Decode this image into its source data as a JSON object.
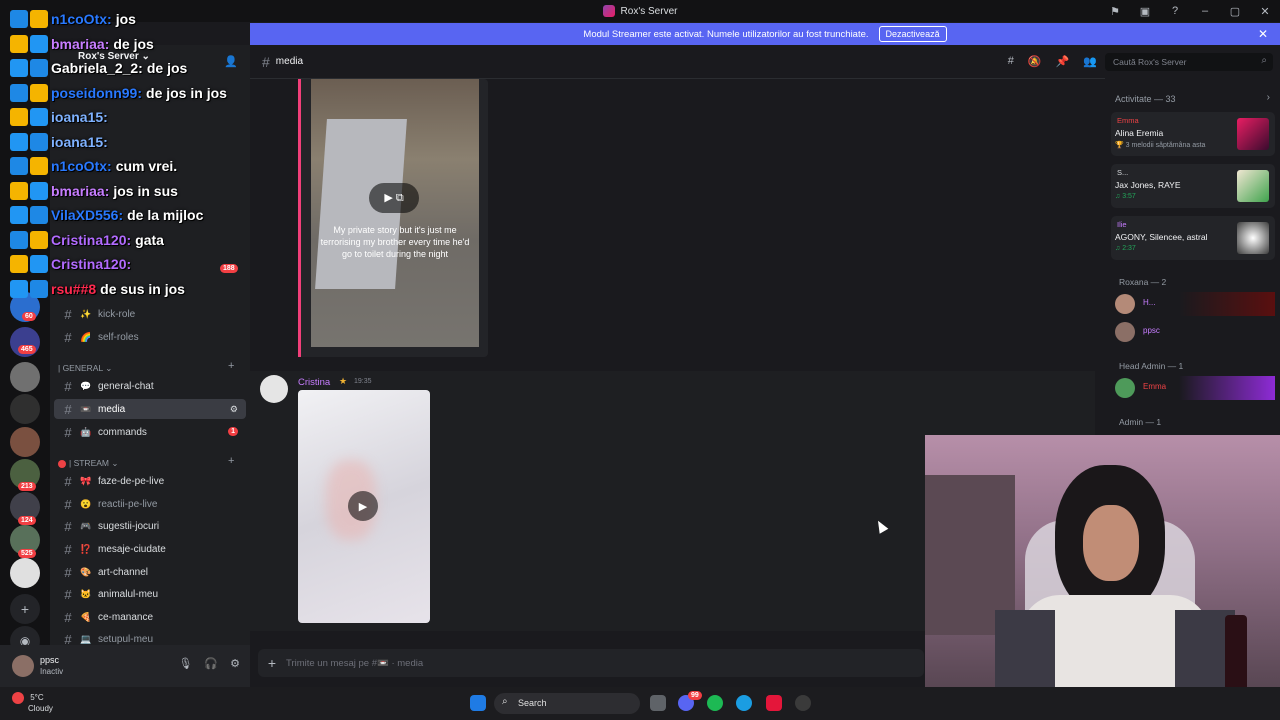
{
  "window": {
    "title": "Rox's Server",
    "controls": [
      "–",
      "▢",
      "✕"
    ]
  },
  "banner": {
    "text": "Modul Streamer este activat. Numele utilizatorilor au fost trunchiate.",
    "button": "Dezactivează",
    "close": "✕"
  },
  "server_list": {
    "badges": [
      "465",
      "213",
      "124",
      "525",
      "60"
    ]
  },
  "sidebar": {
    "server_name": "Rox's Server ⌄",
    "channels_top": [
      {
        "emoji": "✨",
        "label": "kick-role"
      },
      {
        "emoji": "🌈",
        "label": "self-roles"
      }
    ],
    "category_general": "| GENERAL ⌄",
    "channels_general": [
      {
        "emoji": "💬",
        "label": "general-chat"
      },
      {
        "emoji": "📼",
        "label": "media"
      },
      {
        "emoji": "🤖",
        "label": "commands",
        "badge": "1"
      }
    ],
    "category_stream": "| STREAM ⌄",
    "channels_stream": [
      {
        "emoji": "🎀",
        "label": "faze-de-pe-live"
      },
      {
        "emoji": "😮",
        "label": "reactii-pe-live"
      },
      {
        "emoji": "🎮",
        "label": "sugestii-jocuri"
      },
      {
        "emoji": "⁉️",
        "label": "mesaje-ciudate"
      },
      {
        "emoji": "🎨",
        "label": "art-channel"
      },
      {
        "emoji": "🐱",
        "label": "animalul-meu"
      },
      {
        "emoji": "🍕",
        "label": "ce-manance"
      },
      {
        "emoji": "💻",
        "label": "setupul-meu"
      }
    ],
    "mentions_badge": "188"
  },
  "user_panel": {
    "name": "ppsc",
    "status": "Inactiv"
  },
  "channel_header": {
    "name": "media",
    "prefix": "#"
  },
  "search": {
    "placeholder": "Caută Rox's Server"
  },
  "messages": {
    "embed_caption": "My private story but it's just me terrorising my brother every time he'd go to toilet during the night",
    "author": "Cristina",
    "time": "19:35"
  },
  "composer": {
    "placeholder": "Trimite un mesaj pe #📼 · media"
  },
  "activity": {
    "header": "Activitate — 33",
    "cards": [
      {
        "top": "Emma",
        "title": "Alina Eremia",
        "sub": "🏆 3 melodii săptămâna asta"
      },
      {
        "top": "S...",
        "title": "Jax Jones, RAYE",
        "sub": "♫ 3:57"
      },
      {
        "top": "Ilie",
        "title": "AGONY, Silencee, astral",
        "sub": "♫ 2:37"
      }
    ],
    "roles": [
      {
        "label": "Roxana — 2"
      },
      {
        "label": "Head Admin — 1"
      },
      {
        "label": "Admin — 1"
      }
    ],
    "members": [
      "H...",
      "ppsc",
      "Emma"
    ]
  },
  "taskbar": {
    "temp": "5°C",
    "weather": "Cloudy",
    "search": "Search",
    "discord_badge": "99"
  },
  "stream_chat": [
    {
      "user": "n1coOtx:",
      "text": "jos",
      "color": "#2979ff"
    },
    {
      "user": "bmariaa:",
      "text": "de jos",
      "color": "#c77dff"
    },
    {
      "user": "Gabriela_2_2:",
      "text": "de jos",
      "color": "#ffffff"
    },
    {
      "user": "poseidonn99:",
      "text": "de jos in jos",
      "color": "#2979ff"
    },
    {
      "user": "ioana15:",
      "text": "",
      "color": "#7fb2ff"
    },
    {
      "user": "ioana15:",
      "text": "",
      "color": "#7fb2ff"
    },
    {
      "user": "n1coOtx:",
      "text": "cum vrei.",
      "color": "#2979ff"
    },
    {
      "user": "bmariaa:",
      "text": "jos in sus",
      "color": "#c77dff"
    },
    {
      "user": "VilaXD556:",
      "text": "de la mijloc",
      "color": "#2979ff"
    },
    {
      "user": "Cristina120:",
      "text": "gata",
      "color": "#b26bff"
    },
    {
      "user": "Cristina120:",
      "text": "",
      "color": "#b26bff"
    },
    {
      "user": "rsu##8",
      "text": "de sus in jos",
      "color": "#ff2a4f"
    }
  ],
  "colors": {
    "accent": "#5865f2",
    "embed_border": "#f23f7a",
    "danger": "#f23f43"
  }
}
